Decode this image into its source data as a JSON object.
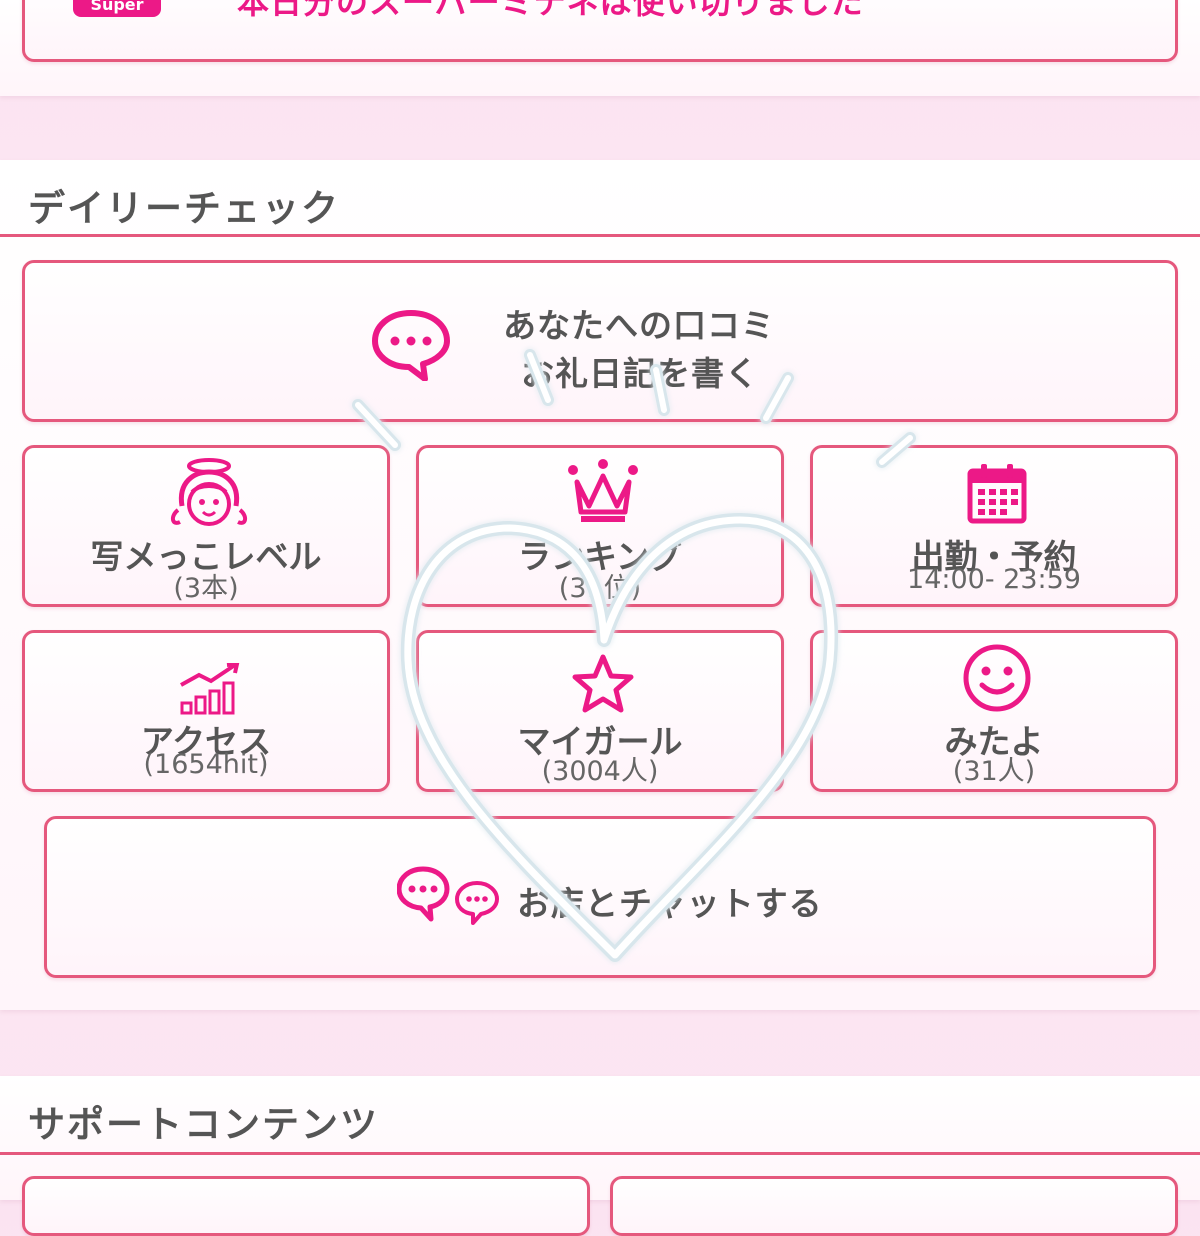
{
  "banner": {
    "badge": "Super",
    "message": "本日分のスーパーミテネは使い切りました"
  },
  "daily_check": {
    "title": "デイリーチェック",
    "review": {
      "line1": "あなたへの口コミ",
      "line2": "お礼日記を書く",
      "icon": "chat-bubble-icon"
    },
    "tiles": [
      {
        "label": "写メっこレベル",
        "sub": "(3本)",
        "icon": "angel-girl-icon"
      },
      {
        "label": "ランキング",
        "sub": "(31位)",
        "icon": "crown-icon"
      },
      {
        "label": "出勤・予約",
        "sub": "14:00- 23:59",
        "icon": "calendar-icon"
      },
      {
        "label": "アクセス",
        "sub": "(1654hit)",
        "icon": "bar-chart-up-icon"
      },
      {
        "label": "マイガール",
        "sub": "(3004人)",
        "icon": "star-icon"
      },
      {
        "label": "みたよ",
        "sub": "(31人)",
        "icon": "smiley-icon"
      }
    ],
    "chat": {
      "label": "お店とチャットする",
      "icon": "double-chat-bubble-icon"
    }
  },
  "support": {
    "title": "サポートコンテンツ"
  },
  "colors": {
    "accent": "#ec1987",
    "border": "#e5587d",
    "overlay": "#ffffff"
  }
}
